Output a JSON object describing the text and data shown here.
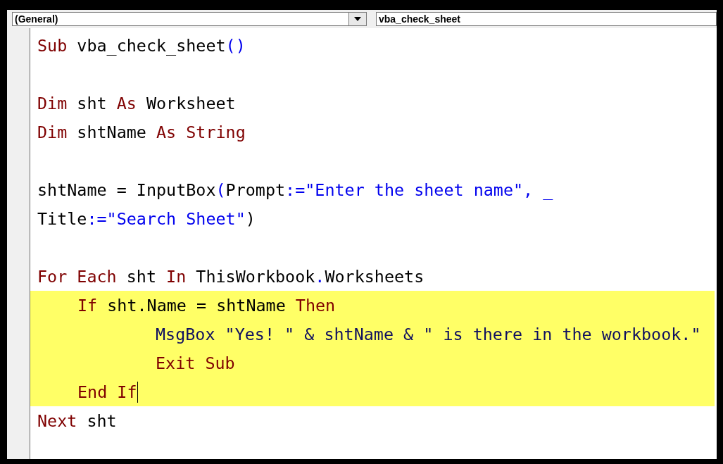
{
  "toolbar": {
    "object_dropdown": "(General)",
    "procedure_dropdown": "vba_check_sheet"
  },
  "lines": [
    {
      "kind": "code",
      "highlighted": false,
      "tokens": [
        {
          "kind": "keyword",
          "text": "Sub"
        },
        {
          "kind": "plain",
          "text": " vba_check_sheet"
        },
        {
          "kind": "blue",
          "text": "()"
        }
      ]
    },
    {
      "kind": "blank"
    },
    {
      "kind": "code",
      "highlighted": false,
      "tokens": [
        {
          "kind": "keyword",
          "text": "Dim"
        },
        {
          "kind": "plain",
          "text": " sht "
        },
        {
          "kind": "keyword",
          "text": "As"
        },
        {
          "kind": "plain",
          "text": " Worksheet"
        }
      ]
    },
    {
      "kind": "code",
      "highlighted": false,
      "tokens": [
        {
          "kind": "keyword",
          "text": "Dim"
        },
        {
          "kind": "plain",
          "text": " shtName "
        },
        {
          "kind": "keyword",
          "text": "As"
        },
        {
          "kind": "keyword",
          "text": " String"
        }
      ]
    },
    {
      "kind": "blank"
    },
    {
      "kind": "code",
      "highlighted": false,
      "tokens": [
        {
          "kind": "plain",
          "text": "shtName = InputBox"
        },
        {
          "kind": "blue",
          "text": "("
        },
        {
          "kind": "plain",
          "text": "Prompt"
        },
        {
          "kind": "blue",
          "text": ":=\"Enter the sheet name\", _"
        }
      ]
    },
    {
      "kind": "code",
      "highlighted": false,
      "tokens": [
        {
          "kind": "plain",
          "text": "Title"
        },
        {
          "kind": "blue",
          "text": ":=\"Search Sheet\""
        },
        {
          "kind": "plain",
          "text": ")"
        }
      ]
    },
    {
      "kind": "blank"
    },
    {
      "kind": "code",
      "highlighted": false,
      "tokens": [
        {
          "kind": "keyword",
          "text": "For Each"
        },
        {
          "kind": "plain",
          "text": " sht "
        },
        {
          "kind": "keyword",
          "text": "In"
        },
        {
          "kind": "plain",
          "text": " ThisWorkbook"
        },
        {
          "kind": "blue",
          "text": "."
        },
        {
          "kind": "plain",
          "text": "Worksheets"
        }
      ],
      "children": [
        {
          "kind": "code",
          "highlighted": true,
          "tokens": [
            {
              "kind": "keyword",
              "text": "If"
            },
            {
              "kind": "plain",
              "text": " sht.Name = shtName "
            },
            {
              "kind": "keyword",
              "text": "Then"
            }
          ],
          "children": [
            {
              "kind": "code",
              "highlighted": true,
              "tokens": [
                {
                  "kind": "navy",
                  "text": "MsgBox \"Yes! \" & shtName & \" is there in the workbook.\""
                }
              ]
            },
            {
              "kind": "code",
              "highlighted": true,
              "tokens": [
                {
                  "kind": "keyword",
                  "text": "Exit Sub"
                }
              ]
            }
          ]
        },
        {
          "kind": "code",
          "highlighted": true,
          "caret": true,
          "tokens": [
            {
              "kind": "keyword",
              "text": "End If"
            }
          ]
        }
      ]
    },
    {
      "kind": "code",
      "highlighted": false,
      "tokens": [
        {
          "kind": "keyword",
          "text": "Next"
        },
        {
          "kind": "plain",
          "text": " sht"
        }
      ]
    }
  ]
}
